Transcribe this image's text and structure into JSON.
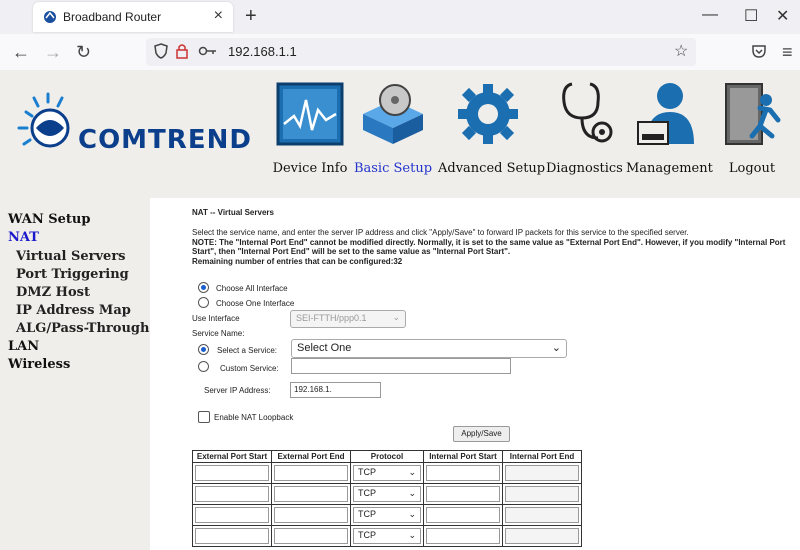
{
  "browser": {
    "tab_title": "Broadband Router",
    "url": "192.168.1.1",
    "close_glyph": "×",
    "newtab_glyph": "+",
    "win_min": "—",
    "win_max": "☐",
    "win_close": "✕",
    "back_glyph": "←",
    "forward_glyph": "→",
    "reload_glyph": "↻",
    "star_glyph": "☆",
    "menu_glyph": "≡"
  },
  "header": {
    "logo": "COMTREND",
    "nav": [
      {
        "label": "Device Info",
        "icon": "device-info-icon"
      },
      {
        "label": "Basic Setup",
        "icon": "basic-setup-icon",
        "active": true
      },
      {
        "label": "Advanced Setup",
        "icon": "advanced-setup-icon"
      },
      {
        "label": "Diagnostics",
        "icon": "stethoscope-icon"
      },
      {
        "label": "Management",
        "icon": "management-icon"
      },
      {
        "label": "Logout",
        "icon": "logout-icon"
      }
    ]
  },
  "sidebar": {
    "items": [
      {
        "label": "WAN Setup"
      },
      {
        "label": "NAT",
        "active": true
      },
      {
        "label": "Virtual Servers"
      },
      {
        "label": "Port Triggering"
      },
      {
        "label": "DMZ Host"
      },
      {
        "label": "IP Address Map"
      },
      {
        "label": "ALG/Pass-Through"
      },
      {
        "label": "LAN"
      },
      {
        "label": "Wireless"
      }
    ]
  },
  "main": {
    "title": "NAT -- Virtual Servers",
    "desc1": "Select the service name, and enter the server IP address and click \"Apply/Save\" to forward IP packets for this service to the specified server.",
    "desc2": "NOTE: The \"Internal Port End\" cannot be modified directly. Normally, it is set to the same value as \"External Port End\". However, if you modify \"Internal Port Start\", then \"Internal Port End\" will be set to the same value as \"Internal Port Start\".",
    "desc3": "Remaining number of entries that can be configured:32",
    "choose_all": "Choose All Interface",
    "choose_one": "Choose One Interface",
    "use_interface_label": "Use Interface",
    "use_interface_value": "SEI-FTTH/ppp0.1",
    "service_name_label": "Service Name:",
    "select_service_label": "Select a Service:",
    "select_service_value": "Select One",
    "custom_service_label": "Custom Service:",
    "server_ip_label": "Server IP Address:",
    "server_ip_value": "192.168.1.",
    "nat_loopback_label": "Enable NAT Loopback",
    "apply_label": "Apply/Save",
    "table": {
      "headers": [
        "External Port Start",
        "External Port End",
        "Protocol",
        "Internal Port Start",
        "Internal Port End"
      ],
      "protocol": "TCP"
    }
  }
}
